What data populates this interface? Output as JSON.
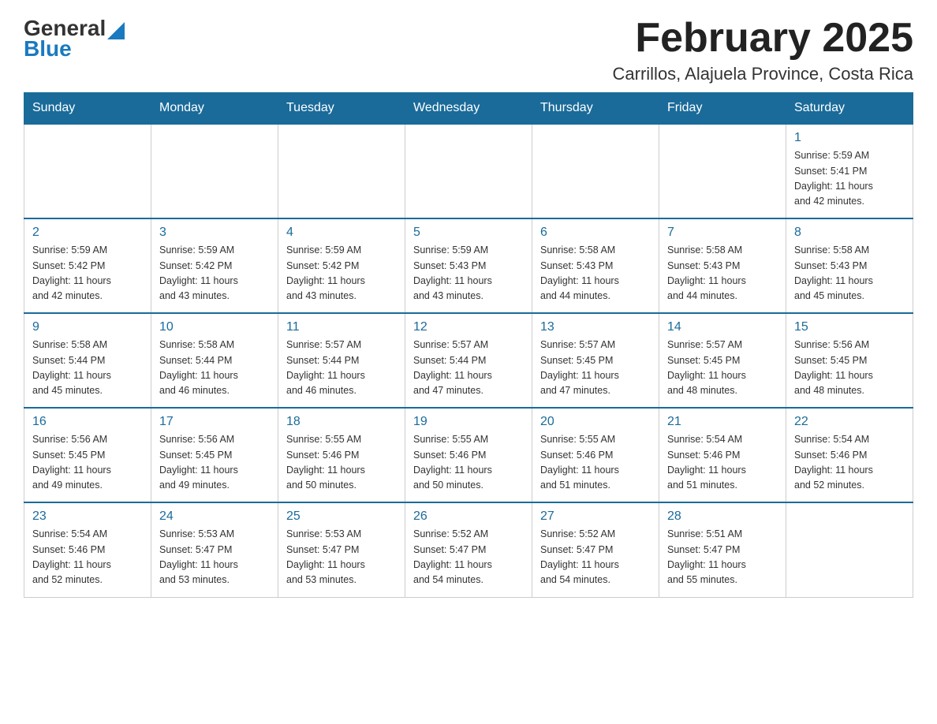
{
  "logo": {
    "general": "General",
    "blue": "Blue"
  },
  "title": "February 2025",
  "location": "Carrillos, Alajuela Province, Costa Rica",
  "days_of_week": [
    "Sunday",
    "Monday",
    "Tuesday",
    "Wednesday",
    "Thursday",
    "Friday",
    "Saturday"
  ],
  "weeks": [
    [
      {
        "day": "",
        "info": ""
      },
      {
        "day": "",
        "info": ""
      },
      {
        "day": "",
        "info": ""
      },
      {
        "day": "",
        "info": ""
      },
      {
        "day": "",
        "info": ""
      },
      {
        "day": "",
        "info": ""
      },
      {
        "day": "1",
        "info": "Sunrise: 5:59 AM\nSunset: 5:41 PM\nDaylight: 11 hours\nand 42 minutes."
      }
    ],
    [
      {
        "day": "2",
        "info": "Sunrise: 5:59 AM\nSunset: 5:42 PM\nDaylight: 11 hours\nand 42 minutes."
      },
      {
        "day": "3",
        "info": "Sunrise: 5:59 AM\nSunset: 5:42 PM\nDaylight: 11 hours\nand 43 minutes."
      },
      {
        "day": "4",
        "info": "Sunrise: 5:59 AM\nSunset: 5:42 PM\nDaylight: 11 hours\nand 43 minutes."
      },
      {
        "day": "5",
        "info": "Sunrise: 5:59 AM\nSunset: 5:43 PM\nDaylight: 11 hours\nand 43 minutes."
      },
      {
        "day": "6",
        "info": "Sunrise: 5:58 AM\nSunset: 5:43 PM\nDaylight: 11 hours\nand 44 minutes."
      },
      {
        "day": "7",
        "info": "Sunrise: 5:58 AM\nSunset: 5:43 PM\nDaylight: 11 hours\nand 44 minutes."
      },
      {
        "day": "8",
        "info": "Sunrise: 5:58 AM\nSunset: 5:43 PM\nDaylight: 11 hours\nand 45 minutes."
      }
    ],
    [
      {
        "day": "9",
        "info": "Sunrise: 5:58 AM\nSunset: 5:44 PM\nDaylight: 11 hours\nand 45 minutes."
      },
      {
        "day": "10",
        "info": "Sunrise: 5:58 AM\nSunset: 5:44 PM\nDaylight: 11 hours\nand 46 minutes."
      },
      {
        "day": "11",
        "info": "Sunrise: 5:57 AM\nSunset: 5:44 PM\nDaylight: 11 hours\nand 46 minutes."
      },
      {
        "day": "12",
        "info": "Sunrise: 5:57 AM\nSunset: 5:44 PM\nDaylight: 11 hours\nand 47 minutes."
      },
      {
        "day": "13",
        "info": "Sunrise: 5:57 AM\nSunset: 5:45 PM\nDaylight: 11 hours\nand 47 minutes."
      },
      {
        "day": "14",
        "info": "Sunrise: 5:57 AM\nSunset: 5:45 PM\nDaylight: 11 hours\nand 48 minutes."
      },
      {
        "day": "15",
        "info": "Sunrise: 5:56 AM\nSunset: 5:45 PM\nDaylight: 11 hours\nand 48 minutes."
      }
    ],
    [
      {
        "day": "16",
        "info": "Sunrise: 5:56 AM\nSunset: 5:45 PM\nDaylight: 11 hours\nand 49 minutes."
      },
      {
        "day": "17",
        "info": "Sunrise: 5:56 AM\nSunset: 5:45 PM\nDaylight: 11 hours\nand 49 minutes."
      },
      {
        "day": "18",
        "info": "Sunrise: 5:55 AM\nSunset: 5:46 PM\nDaylight: 11 hours\nand 50 minutes."
      },
      {
        "day": "19",
        "info": "Sunrise: 5:55 AM\nSunset: 5:46 PM\nDaylight: 11 hours\nand 50 minutes."
      },
      {
        "day": "20",
        "info": "Sunrise: 5:55 AM\nSunset: 5:46 PM\nDaylight: 11 hours\nand 51 minutes."
      },
      {
        "day": "21",
        "info": "Sunrise: 5:54 AM\nSunset: 5:46 PM\nDaylight: 11 hours\nand 51 minutes."
      },
      {
        "day": "22",
        "info": "Sunrise: 5:54 AM\nSunset: 5:46 PM\nDaylight: 11 hours\nand 52 minutes."
      }
    ],
    [
      {
        "day": "23",
        "info": "Sunrise: 5:54 AM\nSunset: 5:46 PM\nDaylight: 11 hours\nand 52 minutes."
      },
      {
        "day": "24",
        "info": "Sunrise: 5:53 AM\nSunset: 5:47 PM\nDaylight: 11 hours\nand 53 minutes."
      },
      {
        "day": "25",
        "info": "Sunrise: 5:53 AM\nSunset: 5:47 PM\nDaylight: 11 hours\nand 53 minutes."
      },
      {
        "day": "26",
        "info": "Sunrise: 5:52 AM\nSunset: 5:47 PM\nDaylight: 11 hours\nand 54 minutes."
      },
      {
        "day": "27",
        "info": "Sunrise: 5:52 AM\nSunset: 5:47 PM\nDaylight: 11 hours\nand 54 minutes."
      },
      {
        "day": "28",
        "info": "Sunrise: 5:51 AM\nSunset: 5:47 PM\nDaylight: 11 hours\nand 55 minutes."
      },
      {
        "day": "",
        "info": ""
      }
    ]
  ]
}
